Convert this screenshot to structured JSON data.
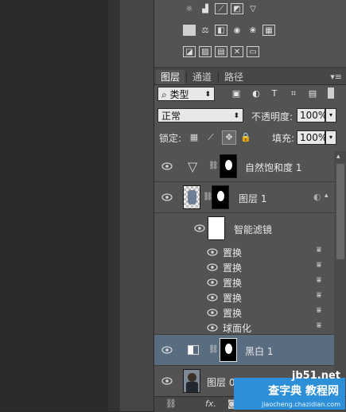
{
  "tabs": {
    "layers": "图层",
    "channels": "通道",
    "paths": "路径",
    "menu_icon": "hamburger-icon"
  },
  "filter": {
    "kind_select": "类型",
    "search_icon": "search-icon"
  },
  "blend": {
    "mode": "正常",
    "opacity_label": "不透明度:",
    "opacity_value": "100%"
  },
  "lock": {
    "label": "锁定:",
    "fill_label": "填充:",
    "fill_value": "100%"
  },
  "layers": [
    {
      "name": "自然饱和度 1",
      "type": "adjustment",
      "visible": true
    },
    {
      "name": "图层 1",
      "type": "smart-object",
      "visible": true
    },
    {
      "name": "智能滤镜",
      "type": "smart-filters",
      "visible": true
    },
    {
      "name": "置换",
      "type": "filter",
      "visible": true
    },
    {
      "name": "置换",
      "type": "filter",
      "visible": true
    },
    {
      "name": "置换",
      "type": "filter",
      "visible": true
    },
    {
      "name": "置换",
      "type": "filter",
      "visible": true
    },
    {
      "name": "置换",
      "type": "filter",
      "visible": true
    },
    {
      "name": "球面化",
      "type": "filter",
      "visible": true
    },
    {
      "name": "黑白 1",
      "type": "adjustment",
      "visible": true,
      "selected": true
    },
    {
      "name": "图层 0",
      "type": "pixel",
      "visible": true
    }
  ],
  "bottom": {
    "fx_label": "fx."
  },
  "watermark": {
    "line1": "jb51.net",
    "line2": "查字典 教程网",
    "line3": "jiaocheng.chazidian.com"
  },
  "colors": {
    "panel_bg": "#535353",
    "selected_row": "#5a6d80",
    "watermark_blue": "#2d8fd8"
  }
}
